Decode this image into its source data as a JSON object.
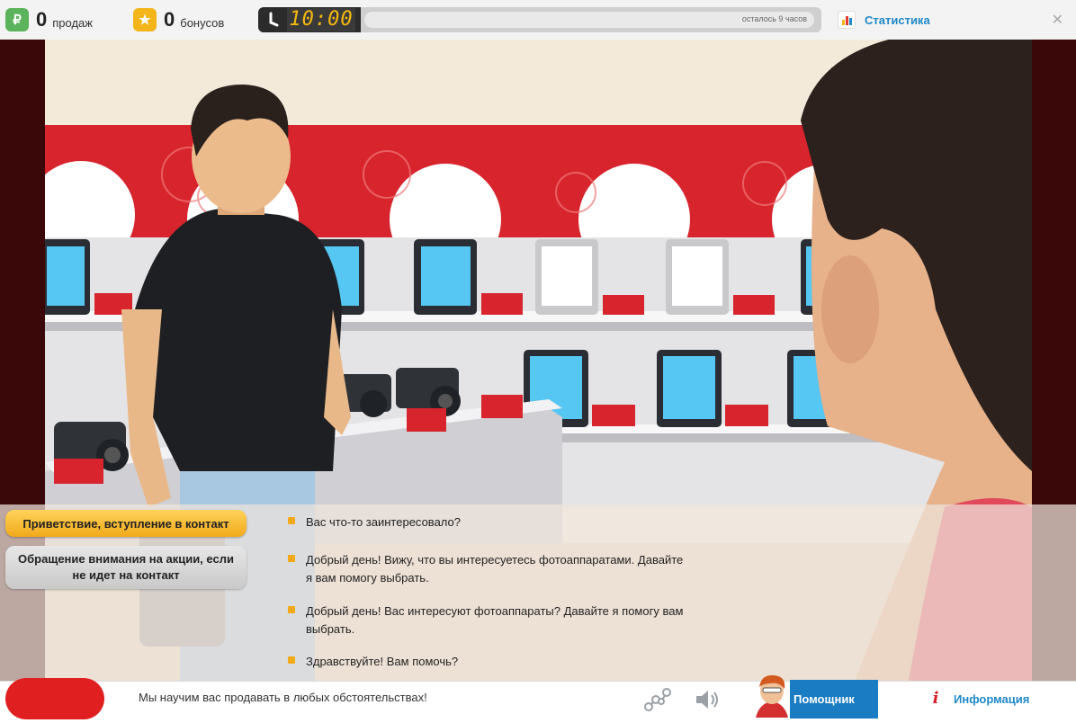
{
  "topbar": {
    "sales": {
      "value": "0",
      "label": "продаж",
      "icon": "ruble-icon",
      "color": "#5bb35b"
    },
    "bonuses": {
      "value": "0",
      "label": "бонусов",
      "icon": "star-icon",
      "color": "#f3b51a"
    },
    "timer": {
      "time": "10:00",
      "remaining_label": "осталось 9 часов",
      "progress": 0
    },
    "stats_link": "Статистика",
    "close_icon": "close-icon"
  },
  "dialog": {
    "categories": [
      {
        "label": "Приветствие, вступление в контакт",
        "active": true
      },
      {
        "label": "Обращение внимания на акции, если не идет на контакт",
        "active": false
      }
    ],
    "answers": [
      "Вас что-то заинтересовало?",
      "Добрый день! Вижу, что вы интересуетесь фотоаппаратами. Давайте я вам помогу выбрать.",
      "Добрый день! Вас интересуют фотоаппараты? Давайте я помогу вам выбрать.",
      "Здравствуйте! Вам помочь?"
    ]
  },
  "bottombar": {
    "slogan": "Мы научим вас продавать в любых обстоятельствах!",
    "helper_label": "Помощник",
    "info_label": "Информация",
    "accent": "#1a7cc2",
    "brand_red": "#e02020"
  }
}
